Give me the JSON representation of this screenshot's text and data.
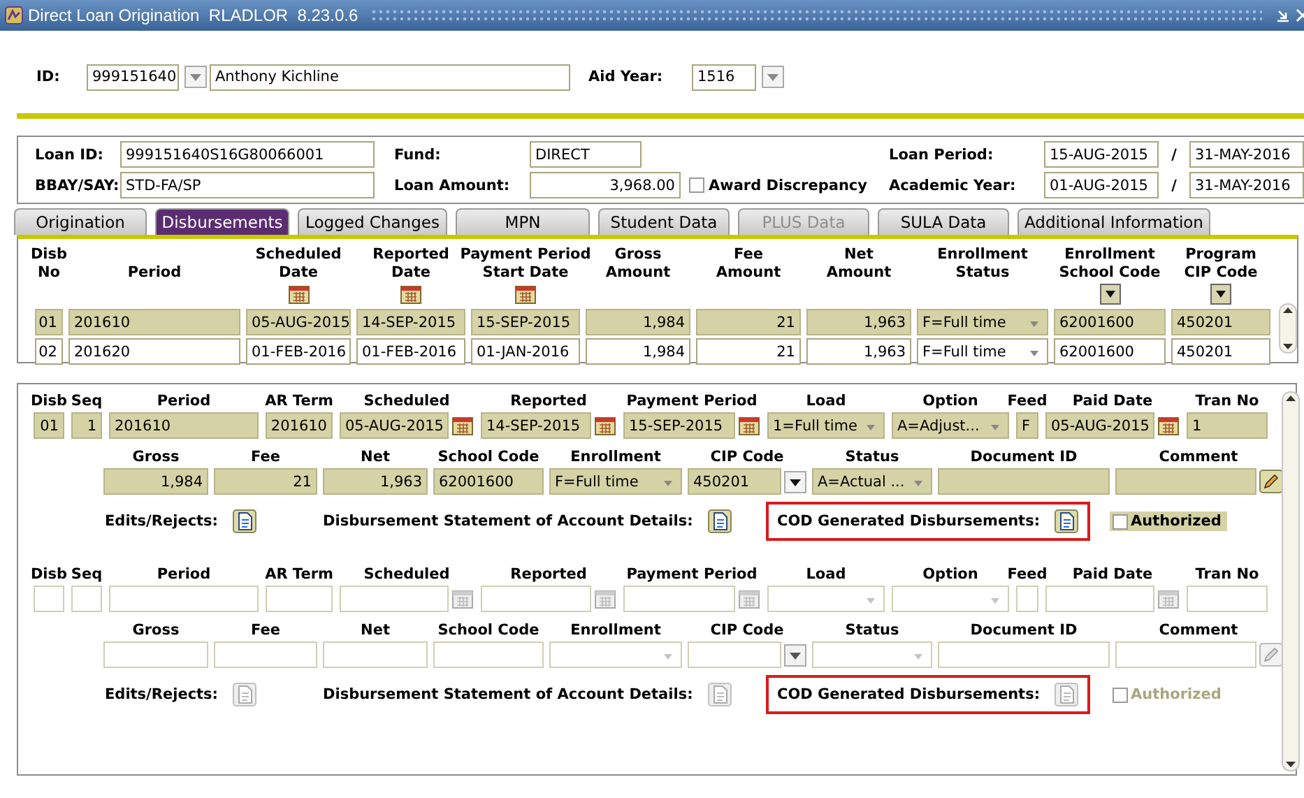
{
  "window": {
    "title": "Direct Loan Origination  RLADLOR  8.23.0.6"
  },
  "key_block": {
    "id_label": "ID:",
    "id": "999151640",
    "name": "Anthony Kichline",
    "aid_year_label": "Aid Year:",
    "aid_year": "1516"
  },
  "loan": {
    "loan_id_label": "Loan ID:",
    "loan_id": "999151640S16G80066001",
    "fund_label": "Fund:",
    "fund": "DIRECT",
    "loan_period_label": "Loan Period:",
    "loan_period_from": "15-AUG-2015",
    "separator_1": "/",
    "loan_period_to": "31-MAY-2016",
    "bbay_label": "BBAY/SAY:",
    "bbay": "STD-FA/SP",
    "amount_label": "Loan Amount:",
    "amount": "3,968.00",
    "award_discrepancy": {
      "label": "Award Discrepancy",
      "checked": false
    },
    "academic_year_label": "Academic Year:",
    "academic_year_from": "01-AUG-2015",
    "separator_2": "/",
    "academic_year_to": "31-MAY-2016"
  },
  "tabs": [
    {
      "label": "Origination",
      "selected": false,
      "disabled": false
    },
    {
      "label": "Disbursements",
      "selected": true,
      "disabled": false
    },
    {
      "label": "Logged Changes",
      "selected": false,
      "disabled": false
    },
    {
      "label": "MPN",
      "selected": false,
      "disabled": false
    },
    {
      "label": "Student Data",
      "selected": false,
      "disabled": false
    },
    {
      "label": "PLUS Data",
      "selected": false,
      "disabled": true
    },
    {
      "label": "SULA Data",
      "selected": false,
      "disabled": false
    },
    {
      "label": "Additional Information",
      "selected": false,
      "disabled": false
    }
  ],
  "disbursement_table": {
    "columns": [
      {
        "label": "Disb\nNo",
        "kind": "number"
      },
      {
        "label": "Period",
        "kind": "text"
      },
      {
        "label": "Scheduled\nDate",
        "kind": "date"
      },
      {
        "label": "Reported\nDate",
        "kind": "date"
      },
      {
        "label": "Payment Period\nStart Date",
        "kind": "date"
      },
      {
        "label": "Gross\nAmount",
        "kind": "number"
      },
      {
        "label": "Fee\nAmount",
        "kind": "number"
      },
      {
        "label": "Net\nAmount",
        "kind": "number"
      },
      {
        "label": "Enrollment\nStatus",
        "kind": "select"
      },
      {
        "label": "Enrollment\nSchool Code",
        "kind": "code"
      },
      {
        "label": "Program\nCIP Code",
        "kind": "code"
      }
    ],
    "rows": [
      {
        "selected": true,
        "cells": [
          "01",
          "201610",
          "05-AUG-2015",
          "14-SEP-2015",
          "15-SEP-2015",
          "1,984",
          "21",
          "1,963",
          "F=Full time",
          "62001600",
          "450201"
        ]
      },
      {
        "selected": false,
        "cells": [
          "02",
          "201620",
          "01-FEB-2016",
          "01-FEB-2016",
          "01-JAN-2016",
          "1,984",
          "21",
          "1,963",
          "F=Full time",
          "62001600",
          "450201"
        ]
      }
    ]
  },
  "disbursement_details": [
    {
      "selected": true,
      "row_1": [
        {
          "label": "Disb",
          "value": "01",
          "kind": "number"
        },
        {
          "label": "Seq",
          "value": "1",
          "kind": "number"
        },
        {
          "label": "Period",
          "value": "201610",
          "kind": "text"
        },
        {
          "label": "AR Term",
          "value": "201610",
          "kind": "number"
        },
        {
          "label": "Scheduled",
          "value": "05-AUG-2015",
          "kind": "date"
        },
        {
          "label": "Reported",
          "value": "14-SEP-2015",
          "kind": "date"
        },
        {
          "label": "Payment Period",
          "value": "15-SEP-2015",
          "kind": "date"
        },
        {
          "label": "Load",
          "value": "1=Full time",
          "kind": "select"
        },
        {
          "label": "Option",
          "value": "A=Adjust...",
          "kind": "select"
        },
        {
          "label": "Feed",
          "value": "F",
          "kind": "text"
        },
        {
          "label": "Paid Date",
          "value": "05-AUG-2015",
          "kind": "date"
        },
        {
          "label": "Tran No",
          "value": "1",
          "kind": "text"
        }
      ],
      "row_2": [
        {
          "label": "Gross",
          "value": "1,984",
          "kind": "number"
        },
        {
          "label": "Fee",
          "value": "21",
          "kind": "number"
        },
        {
          "label": "Net",
          "value": "1,963",
          "kind": "number"
        },
        {
          "label": "School Code",
          "value": "62001600",
          "kind": "text"
        },
        {
          "label": "Enrollment",
          "value": "F=Full time",
          "kind": "select"
        },
        {
          "label": "CIP Code",
          "value": "450201",
          "kind": "lov"
        },
        {
          "label": "Status",
          "value": "A=Actual ...",
          "kind": "select"
        },
        {
          "label": "Document ID",
          "kind": "text"
        },
        {
          "label": "Comment",
          "kind": "edit"
        }
      ],
      "links": [
        {
          "label": "Edits/Rejects:",
          "highlighted": false
        },
        {
          "label": "Disbursement Statement of Account Details:",
          "highlighted": false
        },
        {
          "label": "COD Generated Disbursements:",
          "highlighted": true
        }
      ],
      "authorized": {
        "label": "Authorized",
        "checked": false,
        "disabled": false
      }
    },
    {
      "selected": false,
      "row_1": [
        {
          "label": "Disb",
          "kind": "number"
        },
        {
          "label": "Seq",
          "kind": "number"
        },
        {
          "label": "Period",
          "kind": "text"
        },
        {
          "label": "AR Term",
          "kind": "number"
        },
        {
          "label": "Scheduled",
          "kind": "date"
        },
        {
          "label": "Reported",
          "kind": "date"
        },
        {
          "label": "Payment Period",
          "kind": "date"
        },
        {
          "label": "Load",
          "kind": "select"
        },
        {
          "label": "Option",
          "kind": "select"
        },
        {
          "label": "Feed",
          "kind": "text"
        },
        {
          "label": "Paid Date",
          "kind": "date"
        },
        {
          "label": "Tran No",
          "kind": "text"
        }
      ],
      "row_2": [
        {
          "label": "Gross",
          "kind": "number"
        },
        {
          "label": "Fee",
          "kind": "number"
        },
        {
          "label": "Net",
          "kind": "number"
        },
        {
          "label": "School Code",
          "kind": "text"
        },
        {
          "label": "Enrollment",
          "kind": "select"
        },
        {
          "label": "CIP Code",
          "kind": "lov"
        },
        {
          "label": "Status",
          "kind": "select"
        },
        {
          "label": "Document ID",
          "kind": "text"
        },
        {
          "label": "Comment",
          "kind": "edit"
        }
      ],
      "links": [
        {
          "label": "Edits/Rejects:",
          "highlighted": false
        },
        {
          "label": "Disbursement Statement of Account Details:",
          "highlighted": false
        },
        {
          "label": "COD Generated Disbursements:",
          "highlighted": true
        }
      ],
      "authorized": {
        "label": "Authorized",
        "checked": false,
        "disabled": true
      }
    }
  ]
}
